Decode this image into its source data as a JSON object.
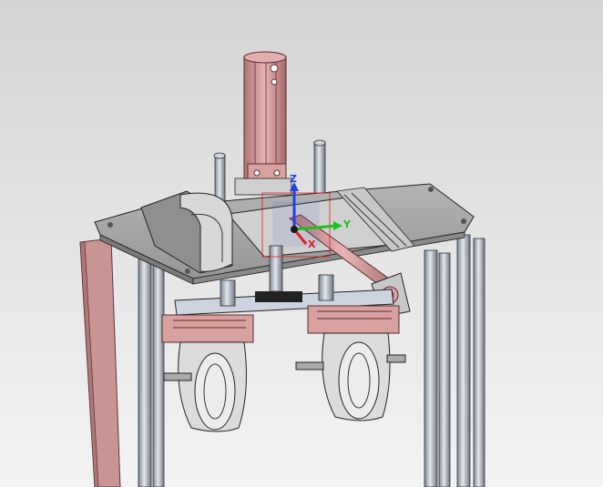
{
  "viewport": {
    "background_top": "#d4d4d4",
    "background_bottom": "#f3f3f3"
  },
  "model": {
    "colors": {
      "steel": "#b9bfc8",
      "plate": "#a3a3a3",
      "pink": "#d9a0a0",
      "pink_dark": "#a86868",
      "dark": "#404040"
    },
    "icons": {
      "cylinder": "pneumatic-cylinder",
      "triad": "coordinate-triad",
      "grippers": "wheel-gripper"
    }
  },
  "triad": {
    "x_label": "X",
    "y_label": "Y",
    "z_label": "Z",
    "x_color": "#e02020",
    "y_color": "#20c020",
    "z_color": "#2040e0"
  }
}
